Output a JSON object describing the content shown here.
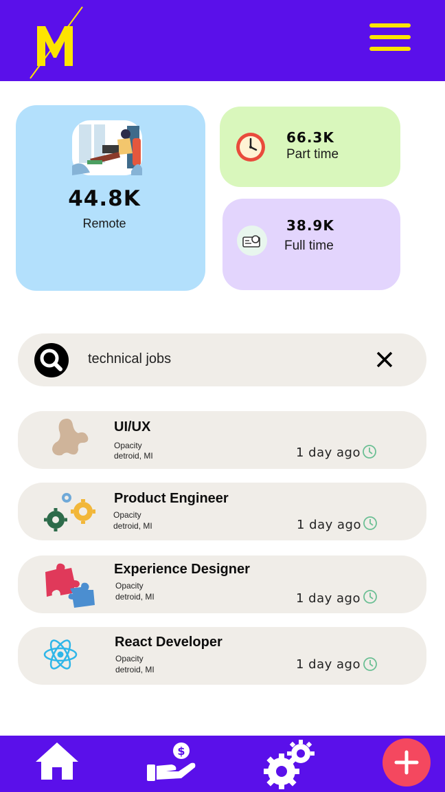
{
  "header": {
    "logo_letter": "M",
    "menu_icon": "hamburger-menu-icon"
  },
  "stats": {
    "remote": {
      "value": "44.8K",
      "label": "Remote",
      "icon": "remote-worker-illustration"
    },
    "part_time": {
      "value": "66.3K",
      "label": "Part time",
      "icon": "clock-icon"
    },
    "full_time": {
      "value": "38.9K",
      "label": "Full time",
      "icon": "projector-icon"
    }
  },
  "search": {
    "value": "technical jobs",
    "icon": "search-icon",
    "clear_icon": "close-icon"
  },
  "jobs": [
    {
      "title": "UI/UX",
      "company": "Opacity",
      "location": "detroid, MI",
      "posted": "1 day ago",
      "icon": "blob-shape-icon"
    },
    {
      "title": "Product Engineer",
      "company": "Opacity",
      "location": "detroid, MI",
      "posted": "1 day ago",
      "icon": "gears-icon"
    },
    {
      "title": "Experience Designer",
      "company": "Opacity",
      "location": "detroid, MI",
      "posted": "1 day ago",
      "icon": "puzzle-icon"
    },
    {
      "title": "React Developer",
      "company": "Opacity",
      "location": "detroid, MI",
      "posted": "1 day ago",
      "icon": "react-atom-icon"
    }
  ],
  "bottom_nav": {
    "items": [
      "home-icon",
      "salary-hand-icon",
      "settings-gears-icon"
    ],
    "fab_icon": "plus-icon"
  },
  "colors": {
    "header_bg": "#5a10ea",
    "accent_yellow": "#fde400",
    "remote_card": "#b3e0fc",
    "part_time_card": "#d9f7bc",
    "full_time_card": "#e3d5fd",
    "list_bg": "#f0ede8",
    "fab": "#f4485f"
  }
}
